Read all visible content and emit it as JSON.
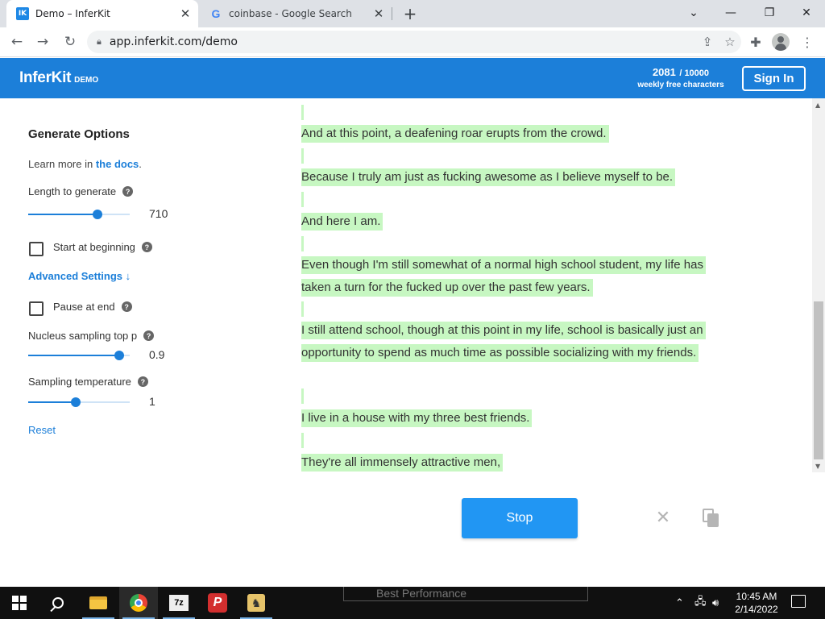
{
  "browser": {
    "tabs": [
      {
        "title": "Demo – InferKit",
        "favicon": "IK"
      },
      {
        "title": "coinbase - Google Search",
        "favicon": "G"
      }
    ],
    "url": "app.inferkit.com/demo"
  },
  "header": {
    "logo": "InferKit",
    "logo_tag": "DEMO",
    "quota_used": "2081",
    "quota_total": "/ 10000",
    "quota_caption": "weekly free characters",
    "signin_label": "Sign In"
  },
  "options": {
    "title": "Generate Options",
    "docs_prefix": "Learn more in ",
    "docs_link": "the docs",
    "docs_suffix": ".",
    "length_label": "Length to generate",
    "length_value": "710",
    "length_fraction": 0.68,
    "start_label": "Start at beginning",
    "advanced_label": "Advanced Settings ↓",
    "pause_label": "Pause at end",
    "nucleus_label": "Nucleus sampling top p",
    "nucleus_value": "0.9",
    "nucleus_fraction": 0.9,
    "temperature_label": "Sampling temperature",
    "temperature_value": "1",
    "temperature_fraction": 0.47,
    "reset_label": "Reset",
    "help_glyph": "?"
  },
  "generated": [
    "And at this point, a deafening roar erupts from the crowd.",
    "Because I truly am just as fucking awesome as I believe myself to be.",
    "And here I am.",
    "Even though I'm still somewhat of a normal high school student, my life has taken a turn for the fucked up over the past few years.",
    "I still attend school, though at this point in my life, school is basically just an opportunity to spend as much time as possible socializing with my friends.",
    "I live in a house with my three best friends.",
    "They're all immensely attractive men,"
  ],
  "actions": {
    "stop_label": "Stop"
  },
  "taskbar": {
    "time": "10:45 AM",
    "date": "2/14/2022",
    "background_window": "Best Performance",
    "sevenzip_label": "7z",
    "p_label": "P"
  },
  "colors": {
    "accent": "#1c7fd9",
    "highlight": "#c7f7c2",
    "stop_button": "#2196f3"
  }
}
